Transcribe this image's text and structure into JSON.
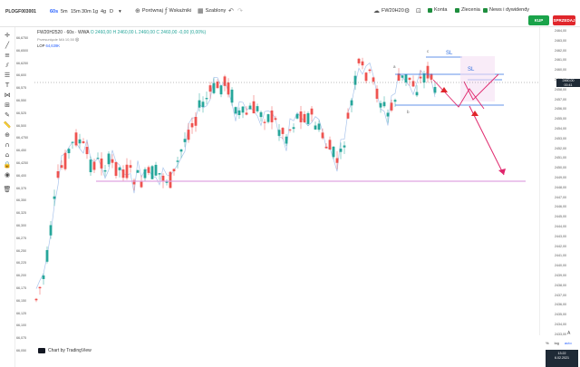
{
  "header": {
    "symbol": "PLOGF003001",
    "timeframes": [
      "60s",
      "5m",
      "15m",
      "30m",
      "1g",
      "4g",
      "D"
    ],
    "active_timeframe": "60s",
    "timeframe_more_icon": "chevron-down-icon",
    "compare_label": "Porównaj",
    "indicators_label": "Wskaźniki",
    "template_label": "Szablony",
    "instrument": "FW20H20",
    "account_label": "Konta",
    "orders_label": "Zlecenia",
    "news_label": "News i dywidendy",
    "buy_label": "KUP",
    "sell_label": "SPRZEDAJ"
  },
  "legend": {
    "title": "FW20H2520 · 60s · WWA",
    "ohlc": "O 2460,00 H 2460,00 L 2460,00 C 2460,00 -0,00 (0,00%)",
    "indicator": "Przesunięcie MA 10,50",
    "lop_label": "LOP",
    "lop_value": "64,639K"
  },
  "left_scale": [
    "66,6750",
    "66,6500",
    "66,6250",
    "66,600",
    "66,575",
    "66,550",
    "66,525",
    "66,500",
    "66,4750",
    "66,450",
    "66,4250",
    "66,400",
    "66,375",
    "66,350",
    "66,325",
    "66,300",
    "66,275",
    "66,250",
    "66,225",
    "66,200",
    "66,175",
    "66,150",
    "66,125",
    "66,100",
    "66,075",
    "66,050"
  ],
  "right_scale": [
    "2464,00",
    "2463,00",
    "2462,00",
    "2461,00",
    "2460,00",
    "2459,00",
    "2458,00",
    "2457,00",
    "2456,00",
    "2455,00",
    "2454,00",
    "2453,00",
    "2452,00",
    "2451,00",
    "2450,00",
    "2449,00",
    "2448,00",
    "2447,00",
    "2446,00",
    "2445,00",
    "2444,00",
    "2443,00",
    "2442,00",
    "2441,00",
    "2440,00",
    "2439,00",
    "2438,00",
    "2437,00",
    "2436,00",
    "2435,00",
    "2434,00",
    "2433,00"
  ],
  "price_tag": {
    "line1": "2460,00",
    "line2": "00:41"
  },
  "annotations": {
    "a": "a",
    "b": "b",
    "c": "c",
    "sl1": "SL",
    "sl2": "SL"
  },
  "footer": {
    "powered_by": "Chart by TradingView",
    "scale_opts": [
      "%",
      "log",
      "auto"
    ],
    "clock_time": "13:22",
    "clock_date": "6.02.2021",
    "collapse_label": "A"
  },
  "colors": {
    "bull": "#26a69a",
    "bear": "#ef5350",
    "ma": "#a9c4ec",
    "support": "#dfa5e0",
    "channel": "#2f6fe0",
    "arrow": "#e0266c"
  }
}
